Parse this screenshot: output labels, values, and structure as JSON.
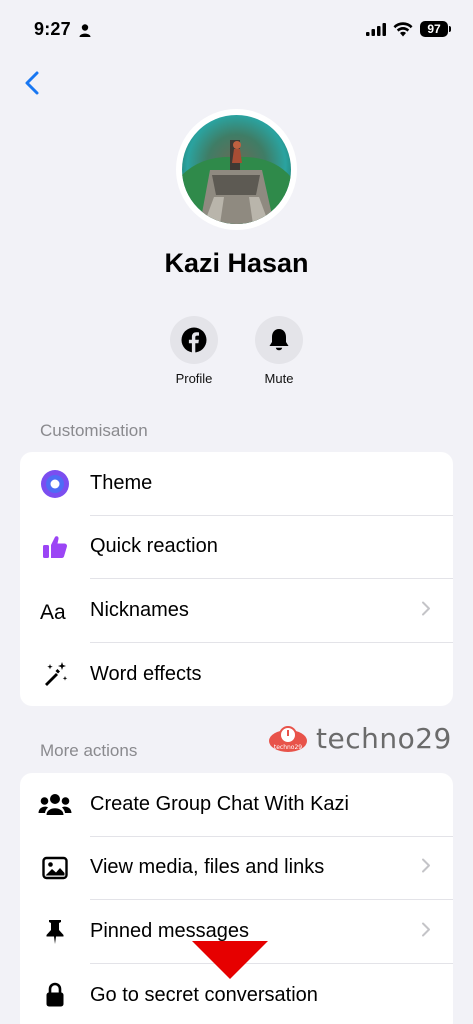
{
  "status_bar": {
    "time": "9:27",
    "battery": "97"
  },
  "profile": {
    "name": "Kazi Hasan"
  },
  "quick_actions": [
    {
      "label": "Profile",
      "icon": "facebook-icon"
    },
    {
      "label": "Mute",
      "icon": "bell-icon"
    }
  ],
  "customisation": {
    "title": "Customisation",
    "items": [
      {
        "label": "Theme",
        "icon": "theme-circle-icon",
        "chevron": false
      },
      {
        "label": "Quick reaction",
        "icon": "thumbs-up-icon",
        "chevron": false
      },
      {
        "label": "Nicknames",
        "icon": "text-aa-icon",
        "chevron": true
      },
      {
        "label": "Word effects",
        "icon": "magic-wand-icon",
        "chevron": false
      }
    ]
  },
  "more_actions": {
    "title": "More actions",
    "items": [
      {
        "label": "Create Group Chat With Kazi",
        "icon": "group-icon",
        "chevron": false
      },
      {
        "label": "View media, files and links",
        "icon": "image-icon",
        "chevron": true
      },
      {
        "label": "Pinned messages",
        "icon": "pin-icon",
        "chevron": true
      },
      {
        "label": "Go to secret conversation",
        "icon": "lock-icon",
        "chevron": false
      }
    ]
  },
  "watermark": {
    "badge": "techno29",
    "text": "techno29"
  },
  "colors": {
    "accent": "#1877f2",
    "theme_purple": "#7b4ef0",
    "reaction_purple": "#9b45f5",
    "annotation_red": "#e60000"
  }
}
